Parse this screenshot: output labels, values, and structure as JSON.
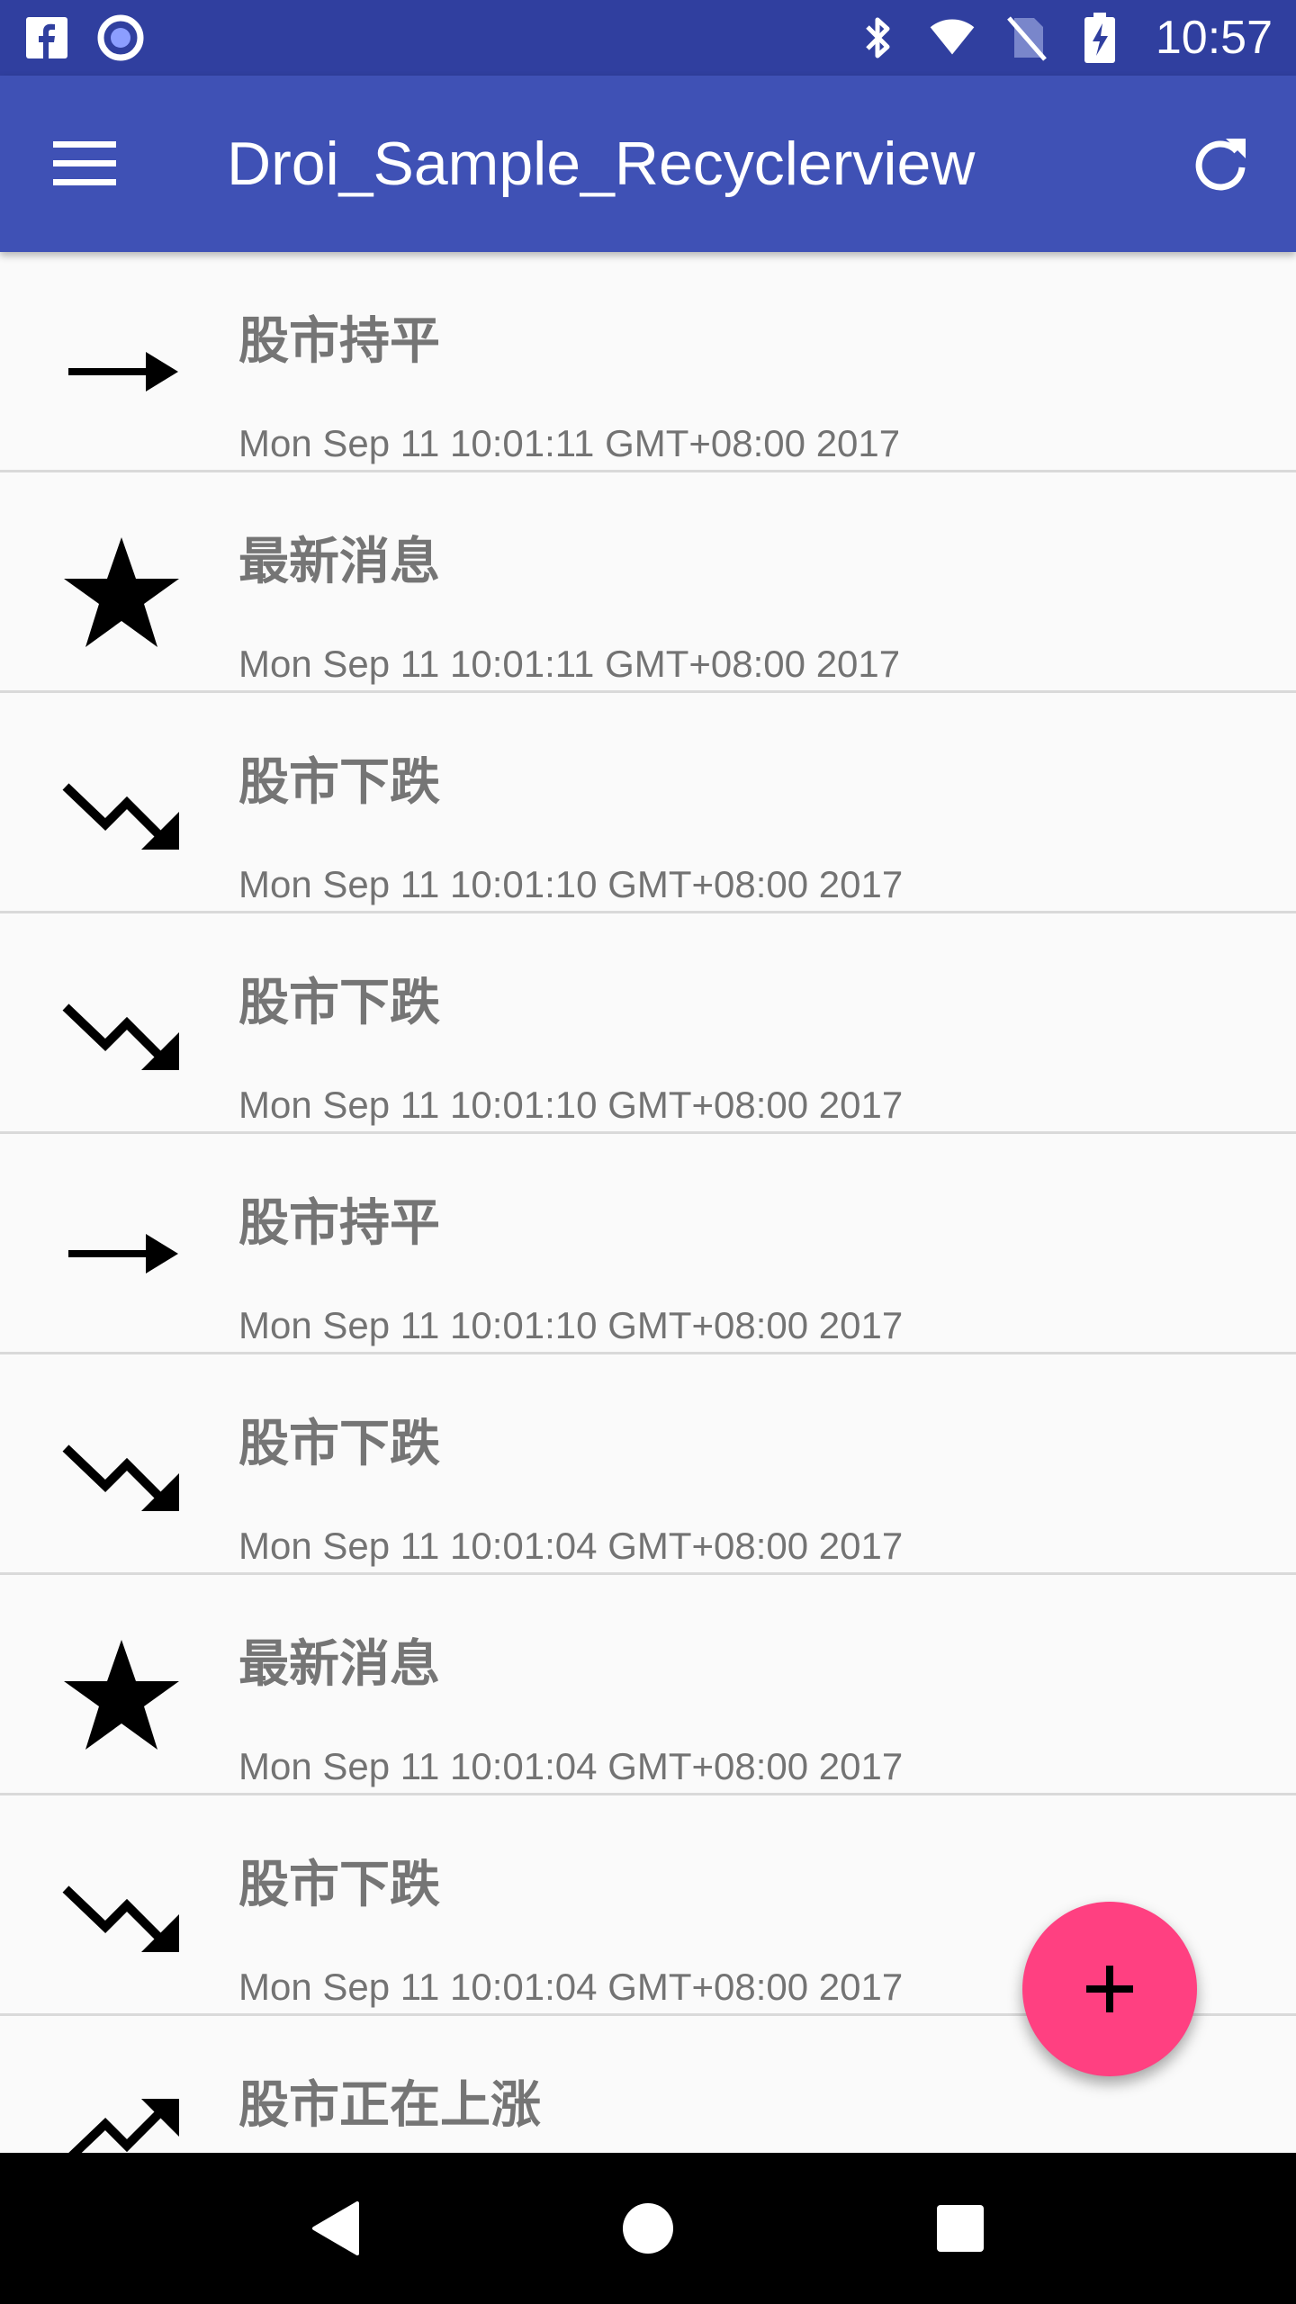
{
  "status_bar": {
    "time": "10:57",
    "left_icons": [
      "facebook-icon",
      "record-icon"
    ],
    "right_icons": [
      "bluetooth-icon",
      "wifi-icon",
      "no-sim-icon",
      "battery-charging-icon"
    ]
  },
  "app_bar": {
    "title": "Droi_Sample_Recyclerview",
    "menu_icon": "menu-icon",
    "refresh_icon": "refresh-icon",
    "color": "#3f51b5"
  },
  "list": {
    "items": [
      {
        "icon": "trending-flat-icon",
        "title": "股市持平",
        "time": "Mon Sep 11 10:01:11 GMT+08:00 2017"
      },
      {
        "icon": "star-icon",
        "title": "最新消息",
        "time": "Mon Sep 11 10:01:11 GMT+08:00 2017"
      },
      {
        "icon": "trending-down-icon",
        "title": "股市下跌",
        "time": "Mon Sep 11 10:01:10 GMT+08:00 2017"
      },
      {
        "icon": "trending-down-icon",
        "title": "股市下跌",
        "time": "Mon Sep 11 10:01:10 GMT+08:00 2017"
      },
      {
        "icon": "trending-flat-icon",
        "title": "股市持平",
        "time": "Mon Sep 11 10:01:10 GMT+08:00 2017"
      },
      {
        "icon": "trending-down-icon",
        "title": "股市下跌",
        "time": "Mon Sep 11 10:01:04 GMT+08:00 2017"
      },
      {
        "icon": "star-icon",
        "title": "最新消息",
        "time": "Mon Sep 11 10:01:04 GMT+08:00 2017"
      },
      {
        "icon": "trending-down-icon",
        "title": "股市下跌",
        "time": "Mon Sep 11 10:01:04 GMT+08:00 2017"
      },
      {
        "icon": "trending-up-icon",
        "title": "股市正在上涨",
        "time": ""
      }
    ]
  },
  "fab": {
    "icon": "add-icon",
    "color": "#ff4081"
  },
  "nav_bar": {
    "icons": [
      "back-icon",
      "home-icon",
      "recents-icon"
    ]
  }
}
